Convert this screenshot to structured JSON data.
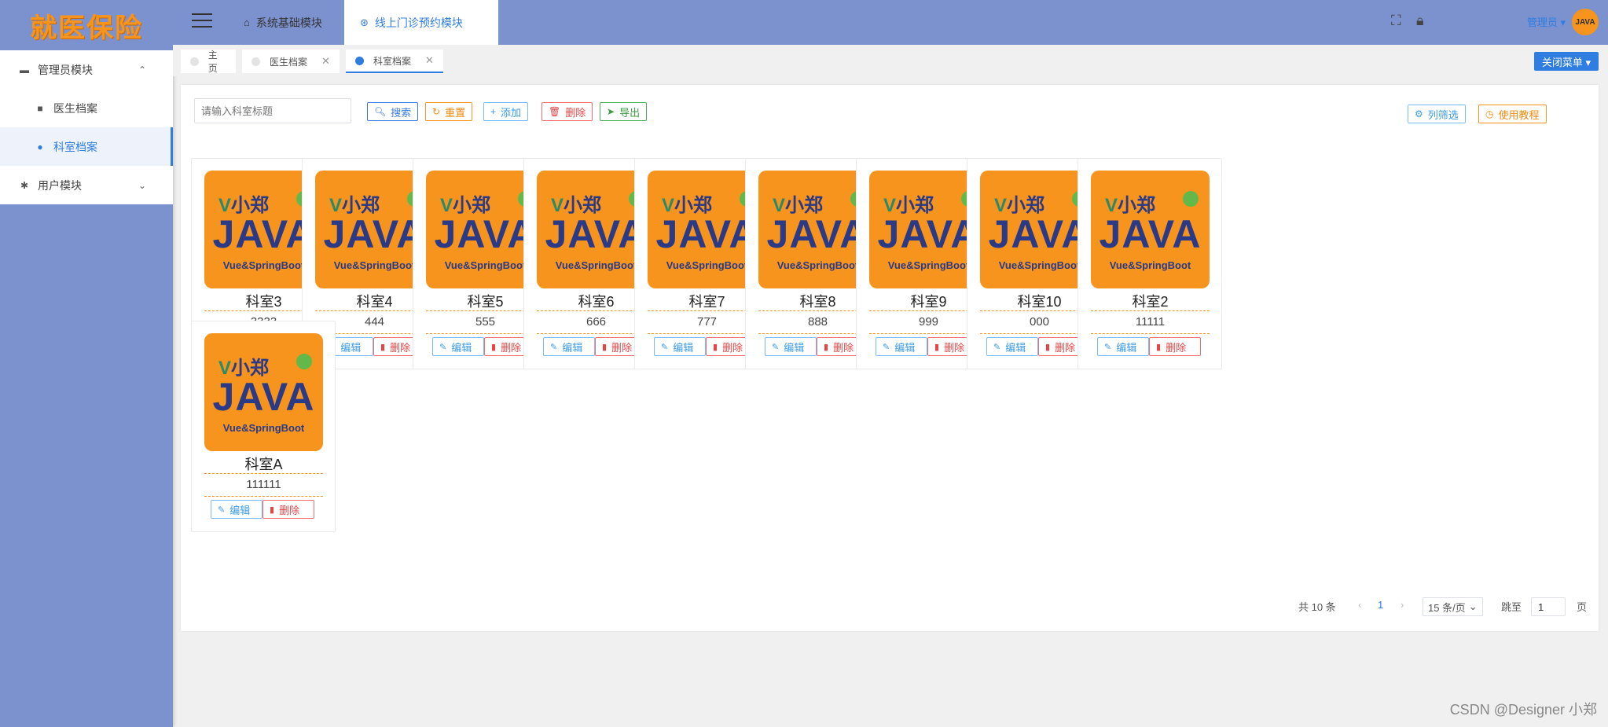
{
  "sidebar": {
    "logo_text": "就医保险",
    "menu": [
      {
        "label": "管理员模块",
        "icon": "bed-icon",
        "glyph": "▬",
        "level": 1,
        "arrow": "⌃",
        "active": false
      },
      {
        "label": "医生档案",
        "icon": "chat-icon",
        "glyph": "■",
        "level": 2,
        "active": false
      },
      {
        "label": "科室档案",
        "icon": "cloud-icon",
        "glyph": "●",
        "level": 2,
        "active": true
      },
      {
        "label": "用户模块",
        "icon": "bug-icon",
        "glyph": "✱",
        "level": 1,
        "arrow": "⌄",
        "active": false
      }
    ]
  },
  "header": {
    "top_tabs": [
      {
        "label": "系统基础模块",
        "icon": "home-icon",
        "glyph": "⌂"
      },
      {
        "label": "线上门诊预约模块",
        "icon": "dribbble-icon",
        "glyph": "⊛"
      }
    ],
    "user_label": "管理员 ▾",
    "avatar_text": "JAVA"
  },
  "tags": [
    {
      "label": "主页",
      "closable": false
    },
    {
      "label": "医生档案",
      "closable": true
    },
    {
      "label": "科室档案",
      "closable": true
    }
  ],
  "close_menu_label": "关闭菜单 ▾",
  "toolbar": {
    "search_placeholder": "请输入科室标题",
    "search": "搜索",
    "reset": "重置",
    "add": "添加",
    "delete": "删除",
    "export": "导出",
    "column_filter": "列筛选",
    "tutorial": "使用教程"
  },
  "card_thumb": {
    "brand": "小郑",
    "title": "JAVA",
    "subtitle": "Vue&SpringBoot"
  },
  "card_actions": {
    "edit": "编辑",
    "delete": "删除"
  },
  "cards": [
    {
      "name": "科室3",
      "code": "3333"
    },
    {
      "name": "科室4",
      "code": "444"
    },
    {
      "name": "科室5",
      "code": "555"
    },
    {
      "name": "科室6",
      "code": "666"
    },
    {
      "name": "科室7",
      "code": "777"
    },
    {
      "name": "科室8",
      "code": "888"
    },
    {
      "name": "科室9",
      "code": "999"
    },
    {
      "name": "科室10",
      "code": "000"
    },
    {
      "name": "科室2",
      "code": "11111"
    },
    {
      "name": "科室A",
      "code": "111111"
    }
  ],
  "pagination": {
    "total": "共 10 条",
    "current_page": "1",
    "page_size": "15 条/页",
    "goto_label": "跳至",
    "goto_value": "1",
    "page_suffix": "页"
  },
  "watermark": "CSDN @Designer 小郑",
  "colors": {
    "accent": "#2f7de1",
    "sidebar_bg": "#7c92cf",
    "logo": "#f7941d"
  }
}
